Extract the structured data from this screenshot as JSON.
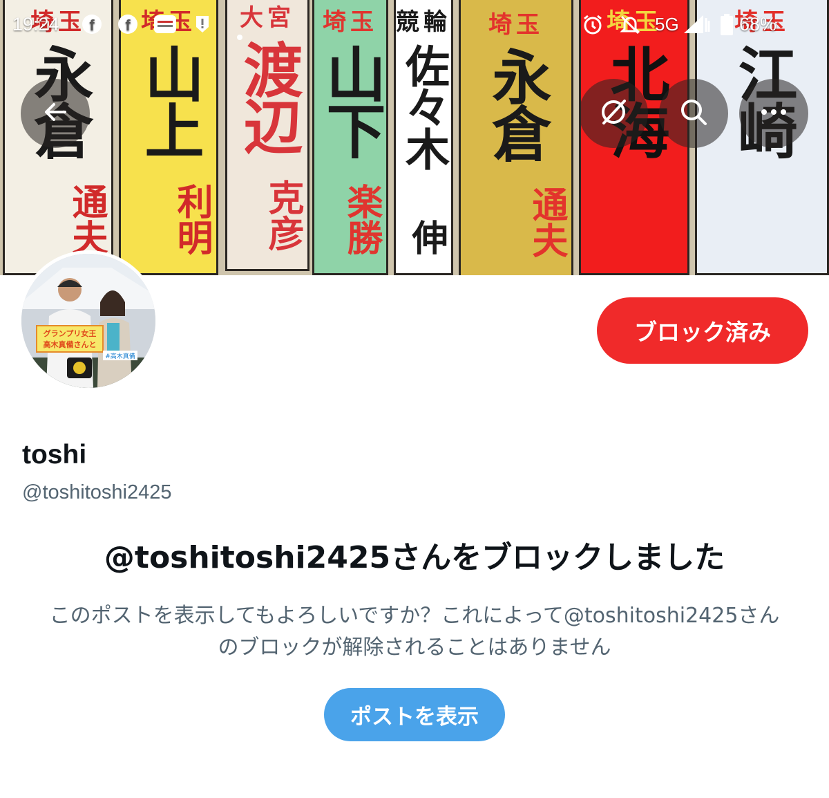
{
  "status_bar": {
    "time": "19:24",
    "network": "5G",
    "battery": "68%"
  },
  "profile": {
    "display_name": "toshi",
    "handle": "@toshitoshi2425",
    "blocked_button_label": "ブロック済み"
  },
  "blocked_notice": {
    "title": "@toshitoshi2425さんをブロックしました",
    "description_line1": "このポストを表示してもよろしいですか？これによって@toshitoshi2425さん",
    "description_line2": "のブロックが解除されることはありません",
    "show_posts_label": "ポストを表示"
  },
  "banner_tags": [
    {
      "top": "埼玉",
      "main": "永倉",
      "sub": "通夫",
      "bg": "#f3efe4",
      "fg": "#1a1a1a",
      "accent": "#d12a2a"
    },
    {
      "top": "埼玉",
      "main": "山上",
      "sub": "利明",
      "bg": "#f7e14d",
      "fg": "#1a1a1a",
      "accent": "#d12a2a"
    },
    {
      "top": "大宮",
      "main": "渡辺",
      "sub": "克彦",
      "bg": "#f0e7db",
      "fg": "#d8353a",
      "accent": "#d8353a"
    },
    {
      "top": "埼玉",
      "main": "山下",
      "sub": "楽勝",
      "bg": "#8fd3a8",
      "fg": "#1a1a1a",
      "accent": "#e0352f"
    },
    {
      "top": "競輪",
      "main": "佐々木",
      "sub": "伸",
      "bg": "#ffffff",
      "fg": "#1a1a1a",
      "accent": "#1a1a1a"
    },
    {
      "top": "埼玉",
      "main": "永倉",
      "sub": "通夫",
      "bg": "#d9b94a",
      "fg": "#1a1a1a",
      "accent": "#e3332c"
    },
    {
      "top": "埼玉",
      "main": "北海",
      "sub": "",
      "bg": "#f21d1d",
      "fg": "#111111",
      "accent": "#f3d640"
    },
    {
      "top": "埼玉",
      "main": "江崎",
      "sub": "",
      "bg": "#e9eef5",
      "fg": "#1a1a1a",
      "accent": "#e2302b"
    }
  ],
  "avatar_text": {
    "line1": "グランプリ女王",
    "line2": "高木真備さんと",
    "tag": "#高木真備"
  },
  "colors": {
    "blocked_red": "#f02a2a",
    "show_blue": "#4aa3ea",
    "secondary_text": "#536471"
  },
  "icons": [
    "back-arrow-icon",
    "grok-icon",
    "search-icon",
    "more-icon",
    "facebook-icon",
    "warning-icon",
    "alarm-icon",
    "notifications-off-icon",
    "signal-icon",
    "battery-icon"
  ]
}
